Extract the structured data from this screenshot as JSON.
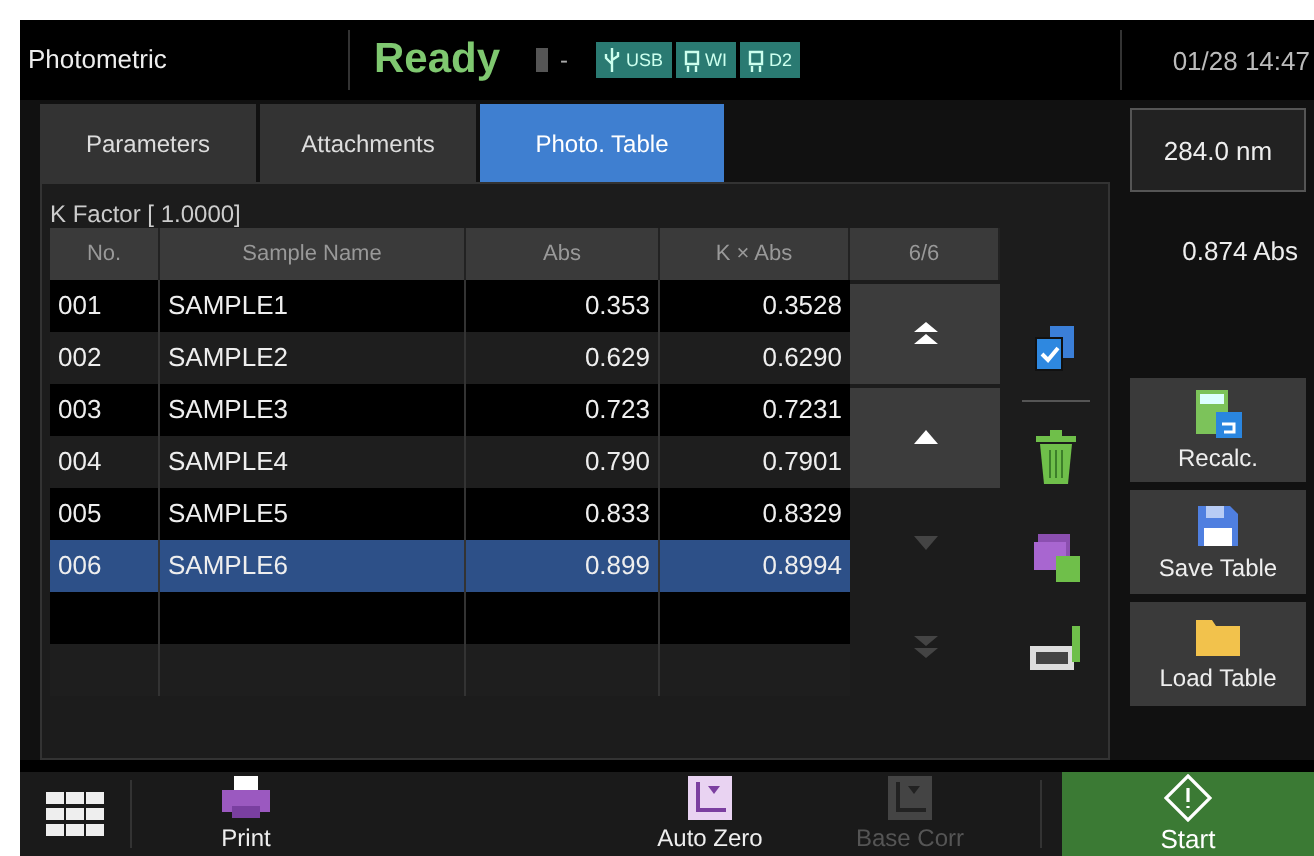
{
  "header": {
    "title": "Photometric",
    "status": "Ready",
    "lamp_text": "-",
    "badges": [
      {
        "label": "USB",
        "kind": "usb"
      },
      {
        "label": "WI",
        "kind": "lamp"
      },
      {
        "label": "D2",
        "kind": "lamp"
      }
    ],
    "datetime": "01/28 14:47"
  },
  "tabs": [
    {
      "label": "Parameters",
      "selected": false
    },
    {
      "label": "Attachments",
      "selected": false
    },
    {
      "label": "Photo. Table",
      "selected": true
    }
  ],
  "k_factor": "K Factor [ 1.0000]",
  "table": {
    "columns": [
      "No.",
      "Sample Name",
      "Abs",
      "K × Abs"
    ],
    "page": "6/6",
    "rows": [
      {
        "no": "001",
        "name": "SAMPLE1",
        "abs": "0.353",
        "k_abs": "0.3528",
        "selected": false
      },
      {
        "no": "002",
        "name": "SAMPLE2",
        "abs": "0.629",
        "k_abs": "0.6290",
        "selected": false
      },
      {
        "no": "003",
        "name": "SAMPLE3",
        "abs": "0.723",
        "k_abs": "0.7231",
        "selected": false
      },
      {
        "no": "004",
        "name": "SAMPLE4",
        "abs": "0.790",
        "k_abs": "0.7901",
        "selected": false
      },
      {
        "no": "005",
        "name": "SAMPLE5",
        "abs": "0.833",
        "k_abs": "0.8329",
        "selected": false
      },
      {
        "no": "006",
        "name": "SAMPLE6",
        "abs": "0.899",
        "k_abs": "0.8994",
        "selected": true
      }
    ]
  },
  "scroll_buttons": [
    {
      "kind": "top",
      "disabled": false
    },
    {
      "kind": "up",
      "disabled": false
    },
    {
      "kind": "down",
      "disabled": true
    },
    {
      "kind": "bottom",
      "disabled": true
    }
  ],
  "tools": [
    {
      "kind": "select"
    },
    {
      "kind": "delete"
    },
    {
      "kind": "delete_all"
    },
    {
      "kind": "rename"
    }
  ],
  "side": {
    "wavelength": "284.0 nm",
    "reading": "0.874 Abs",
    "buttons": [
      {
        "label": "Recalc.",
        "kind": "recalc"
      },
      {
        "label": "Save Table",
        "kind": "save"
      },
      {
        "label": "Load Table",
        "kind": "load"
      }
    ]
  },
  "toolbar": {
    "items": [
      {
        "label": "Print",
        "kind": "print",
        "disabled": false
      },
      {
        "label": "Auto Zero",
        "kind": "autozero",
        "disabled": false
      },
      {
        "label": "Base Corr",
        "kind": "basecorr",
        "disabled": true
      }
    ],
    "start": "Start"
  }
}
